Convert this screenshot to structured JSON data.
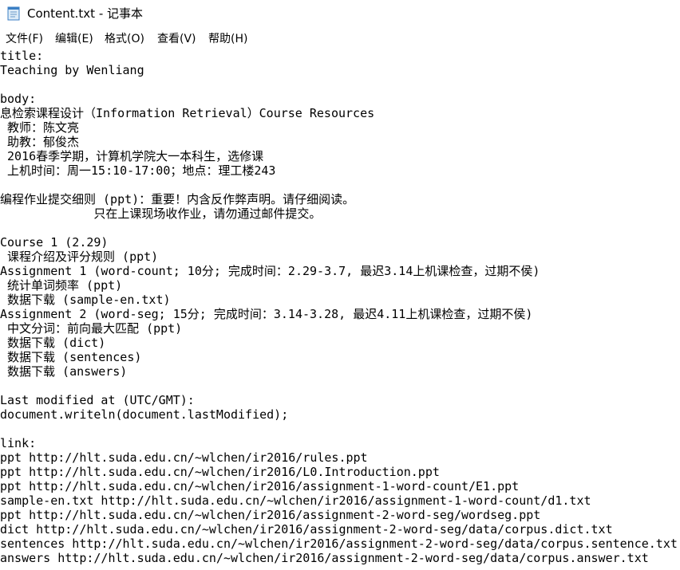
{
  "window": {
    "title": "Content.txt - 记事本",
    "icon": "notepad-icon"
  },
  "menubar": {
    "items": [
      "文件(F)",
      "编辑(E)",
      "格式(O)",
      "查看(V)",
      "帮助(H)"
    ]
  },
  "editor": {
    "lines": [
      "title:",
      "Teaching by Wenliang",
      "",
      "body:",
      "息检索课程设计（Information Retrieval）Course Resources",
      " 教师：陈文亮",
      " 助教：郁俊杰",
      " 2016春季学期，计算机学院大一本科生，选修课",
      " 上机时间：周一15:10-17:00；地点：理工楼243",
      "",
      "编程作业提交细则 (ppt)：重要！内含反作弊声明。请仔细阅读。",
      "             只在上课现场收作业，请勿通过邮件提交。",
      "",
      "Course 1 (2.29)",
      " 课程介绍及评分规则 (ppt)",
      "Assignment 1 (word-count; 10分; 完成时间：2.29-3.7, 最迟3.14上机课检查，过期不侯)",
      " 统计单词频率 (ppt)",
      " 数据下载 (sample-en.txt)",
      "Assignment 2 (word-seg; 15分; 完成时间：3.14-3.28, 最迟4.11上机课检查，过期不侯)",
      " 中文分词：前向最大匹配 (ppt)",
      " 数据下载 (dict)",
      " 数据下载 (sentences)",
      " 数据下载 (answers)",
      "",
      "Last modified at (UTC/GMT):",
      "document.writeln(document.lastModified);",
      "",
      "link:",
      "ppt http://hlt.suda.edu.cn/~wlchen/ir2016/rules.ppt",
      "ppt http://hlt.suda.edu.cn/~wlchen/ir2016/L0.Introduction.ppt",
      "ppt http://hlt.suda.edu.cn/~wlchen/ir2016/assignment-1-word-count/E1.ppt",
      "sample-en.txt http://hlt.suda.edu.cn/~wlchen/ir2016/assignment-1-word-count/d1.txt",
      "ppt http://hlt.suda.edu.cn/~wlchen/ir2016/assignment-2-word-seg/wordseg.ppt",
      "dict http://hlt.suda.edu.cn/~wlchen/ir2016/assignment-2-word-seg/data/corpus.dict.txt",
      "sentences http://hlt.suda.edu.cn/~wlchen/ir2016/assignment-2-word-seg/data/corpus.sentence.txt",
      "answers http://hlt.suda.edu.cn/~wlchen/ir2016/assignment-2-word-seg/data/corpus.answer.txt"
    ]
  }
}
